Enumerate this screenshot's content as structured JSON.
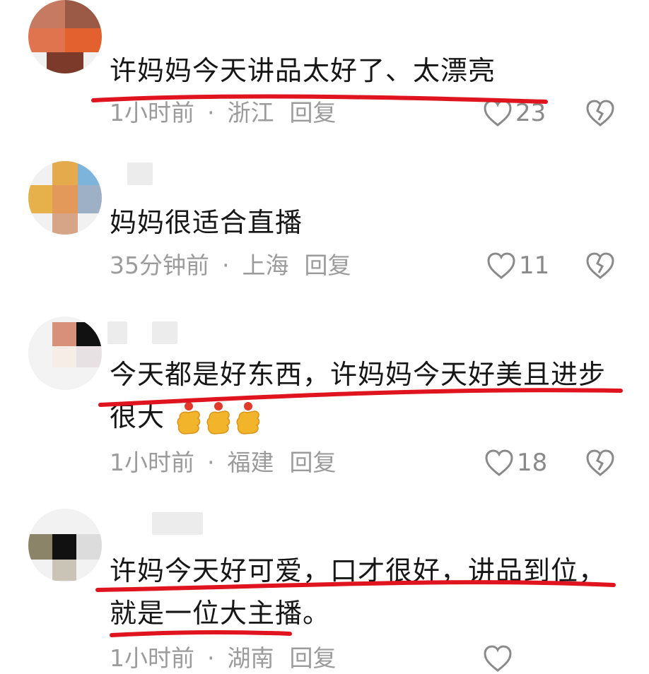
{
  "colors": {
    "text": "#161616",
    "meta": "#9b9b9b",
    "underline": "#e0141e"
  },
  "comments": [
    {
      "text_lines": [
        "许妈妈今天讲品太好了、太漂亮"
      ],
      "time": "1小时前",
      "location": "浙江",
      "reply_label": "回复",
      "likes": "23",
      "like_icon": "heart-outline-icon",
      "dislike_icon": "broken-heart-icon"
    },
    {
      "text_lines": [
        "妈妈很适合直播"
      ],
      "time": "35分钟前",
      "location": "上海",
      "reply_label": "回复",
      "likes": "11",
      "like_icon": "heart-outline-icon",
      "dislike_icon": "broken-heart-icon"
    },
    {
      "text_lines": [
        "今天都是好东西，许妈妈今天好美且进步",
        "很大"
      ],
      "emoji": [
        "finger-heart-emoji",
        "finger-heart-emoji",
        "finger-heart-emoji"
      ],
      "time": "1小时前",
      "location": "福建",
      "reply_label": "回复",
      "likes": "18",
      "like_icon": "heart-outline-icon",
      "dislike_icon": "broken-heart-icon"
    },
    {
      "text_lines": [
        "许妈今天好可爱，口才很好，讲品到位，",
        "就是一位大主播。"
      ],
      "time": "1小时前",
      "location": "湖南",
      "reply_label": "回复",
      "like_icon": "heart-outline-icon"
    }
  ],
  "separator": "·"
}
